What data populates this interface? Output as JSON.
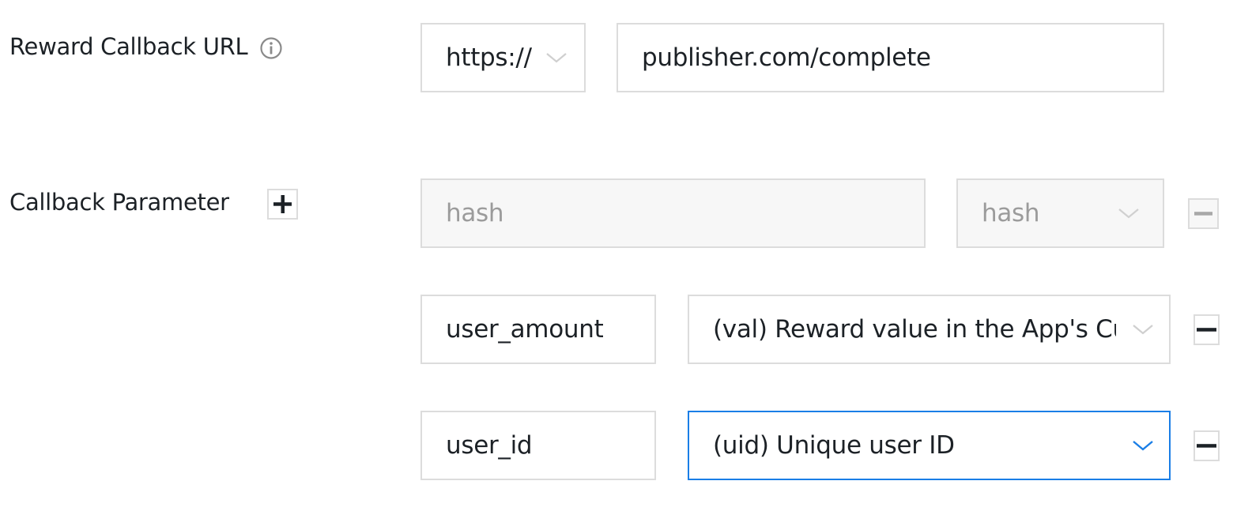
{
  "reward_callback": {
    "label": "Reward Callback URL",
    "info_icon": "info-icon",
    "protocol_selected": "https://",
    "url_value": "publisher.com/complete"
  },
  "callback_parameter": {
    "label": "Callback Parameter",
    "add_icon": "plus-icon",
    "rows": [
      {
        "name": "hash",
        "macro": "hash",
        "disabled": true
      },
      {
        "name": "user_amount",
        "macro": "(val) Reward value in the App's Currency",
        "disabled": false
      },
      {
        "name": "user_id",
        "macro": "(uid) Unique user ID",
        "disabled": false,
        "focused": true
      }
    ]
  },
  "colors": {
    "text": "#1c2126",
    "border": "#dcdcdc",
    "disabled_bg": "#f7f7f7",
    "disabled_text": "#9b9b9b",
    "focus": "#1a7ee6",
    "icon_gray": "#8a8a8a"
  }
}
